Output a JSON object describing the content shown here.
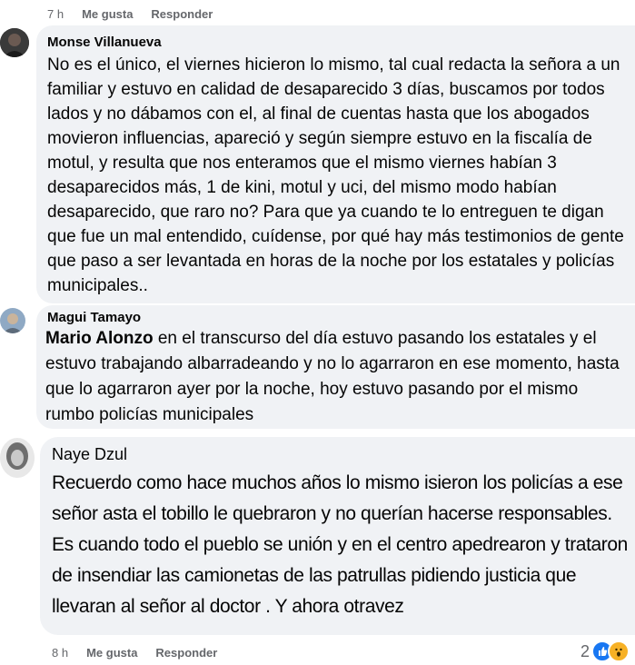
{
  "top_meta": {
    "time": "7 h",
    "like": "Me gusta",
    "reply": "Responder"
  },
  "comments": [
    {
      "author": "Monse Villanueva",
      "text": "No es el único, el viernes hicieron lo mismo, tal cual redacta la señora a un familiar y estuvo en calidad de desaparecido 3 días, buscamos por todos lados y no dábamos con el, al final de cuentas hasta que los abogados movieron influencias, apareció y según siempre estuvo en la fiscalía de motul, y resulta que nos enteramos que el mismo viernes habían 3 desaparecidos más, 1 de kini, motul y uci, del mismo modo habían desaparecido, que raro no? Para que ya cuando te lo entreguen te digan que fue un mal entendido, cuídense, por qué hay más testimonios de gente que paso a ser levantada en horas de la noche por los estatales y policías municipales.."
    },
    {
      "author": "Magui Tamayo",
      "mention": "Mario Alonzo",
      "text": " en el transcurso del día estuvo pasando los estatales y el estuvo trabajando albarradeando y no lo agarraron en ese momento, hasta que lo agarraron ayer por la noche, hoy estuvo pasando por el mismo rumbo policías municipales"
    },
    {
      "author": "Naye Dzul",
      "text": "Recuerdo como hace muchos años lo mismo isieron los policías a ese señor asta el tobillo le quebraron y no querían hacerse responsables. Es cuando todo el pueblo se unión y en el centro apedrearon y trataron de insendiar las camionetas de las patrullas pidiendo justicia que llevaran al señor al doctor . Y ahora otravez"
    }
  ],
  "bottom_meta": {
    "time": "8 h",
    "like": "Me gusta",
    "reply": "Responder"
  },
  "reactions": {
    "count": "2",
    "icons": [
      "like-icon",
      "wow-icon"
    ]
  }
}
